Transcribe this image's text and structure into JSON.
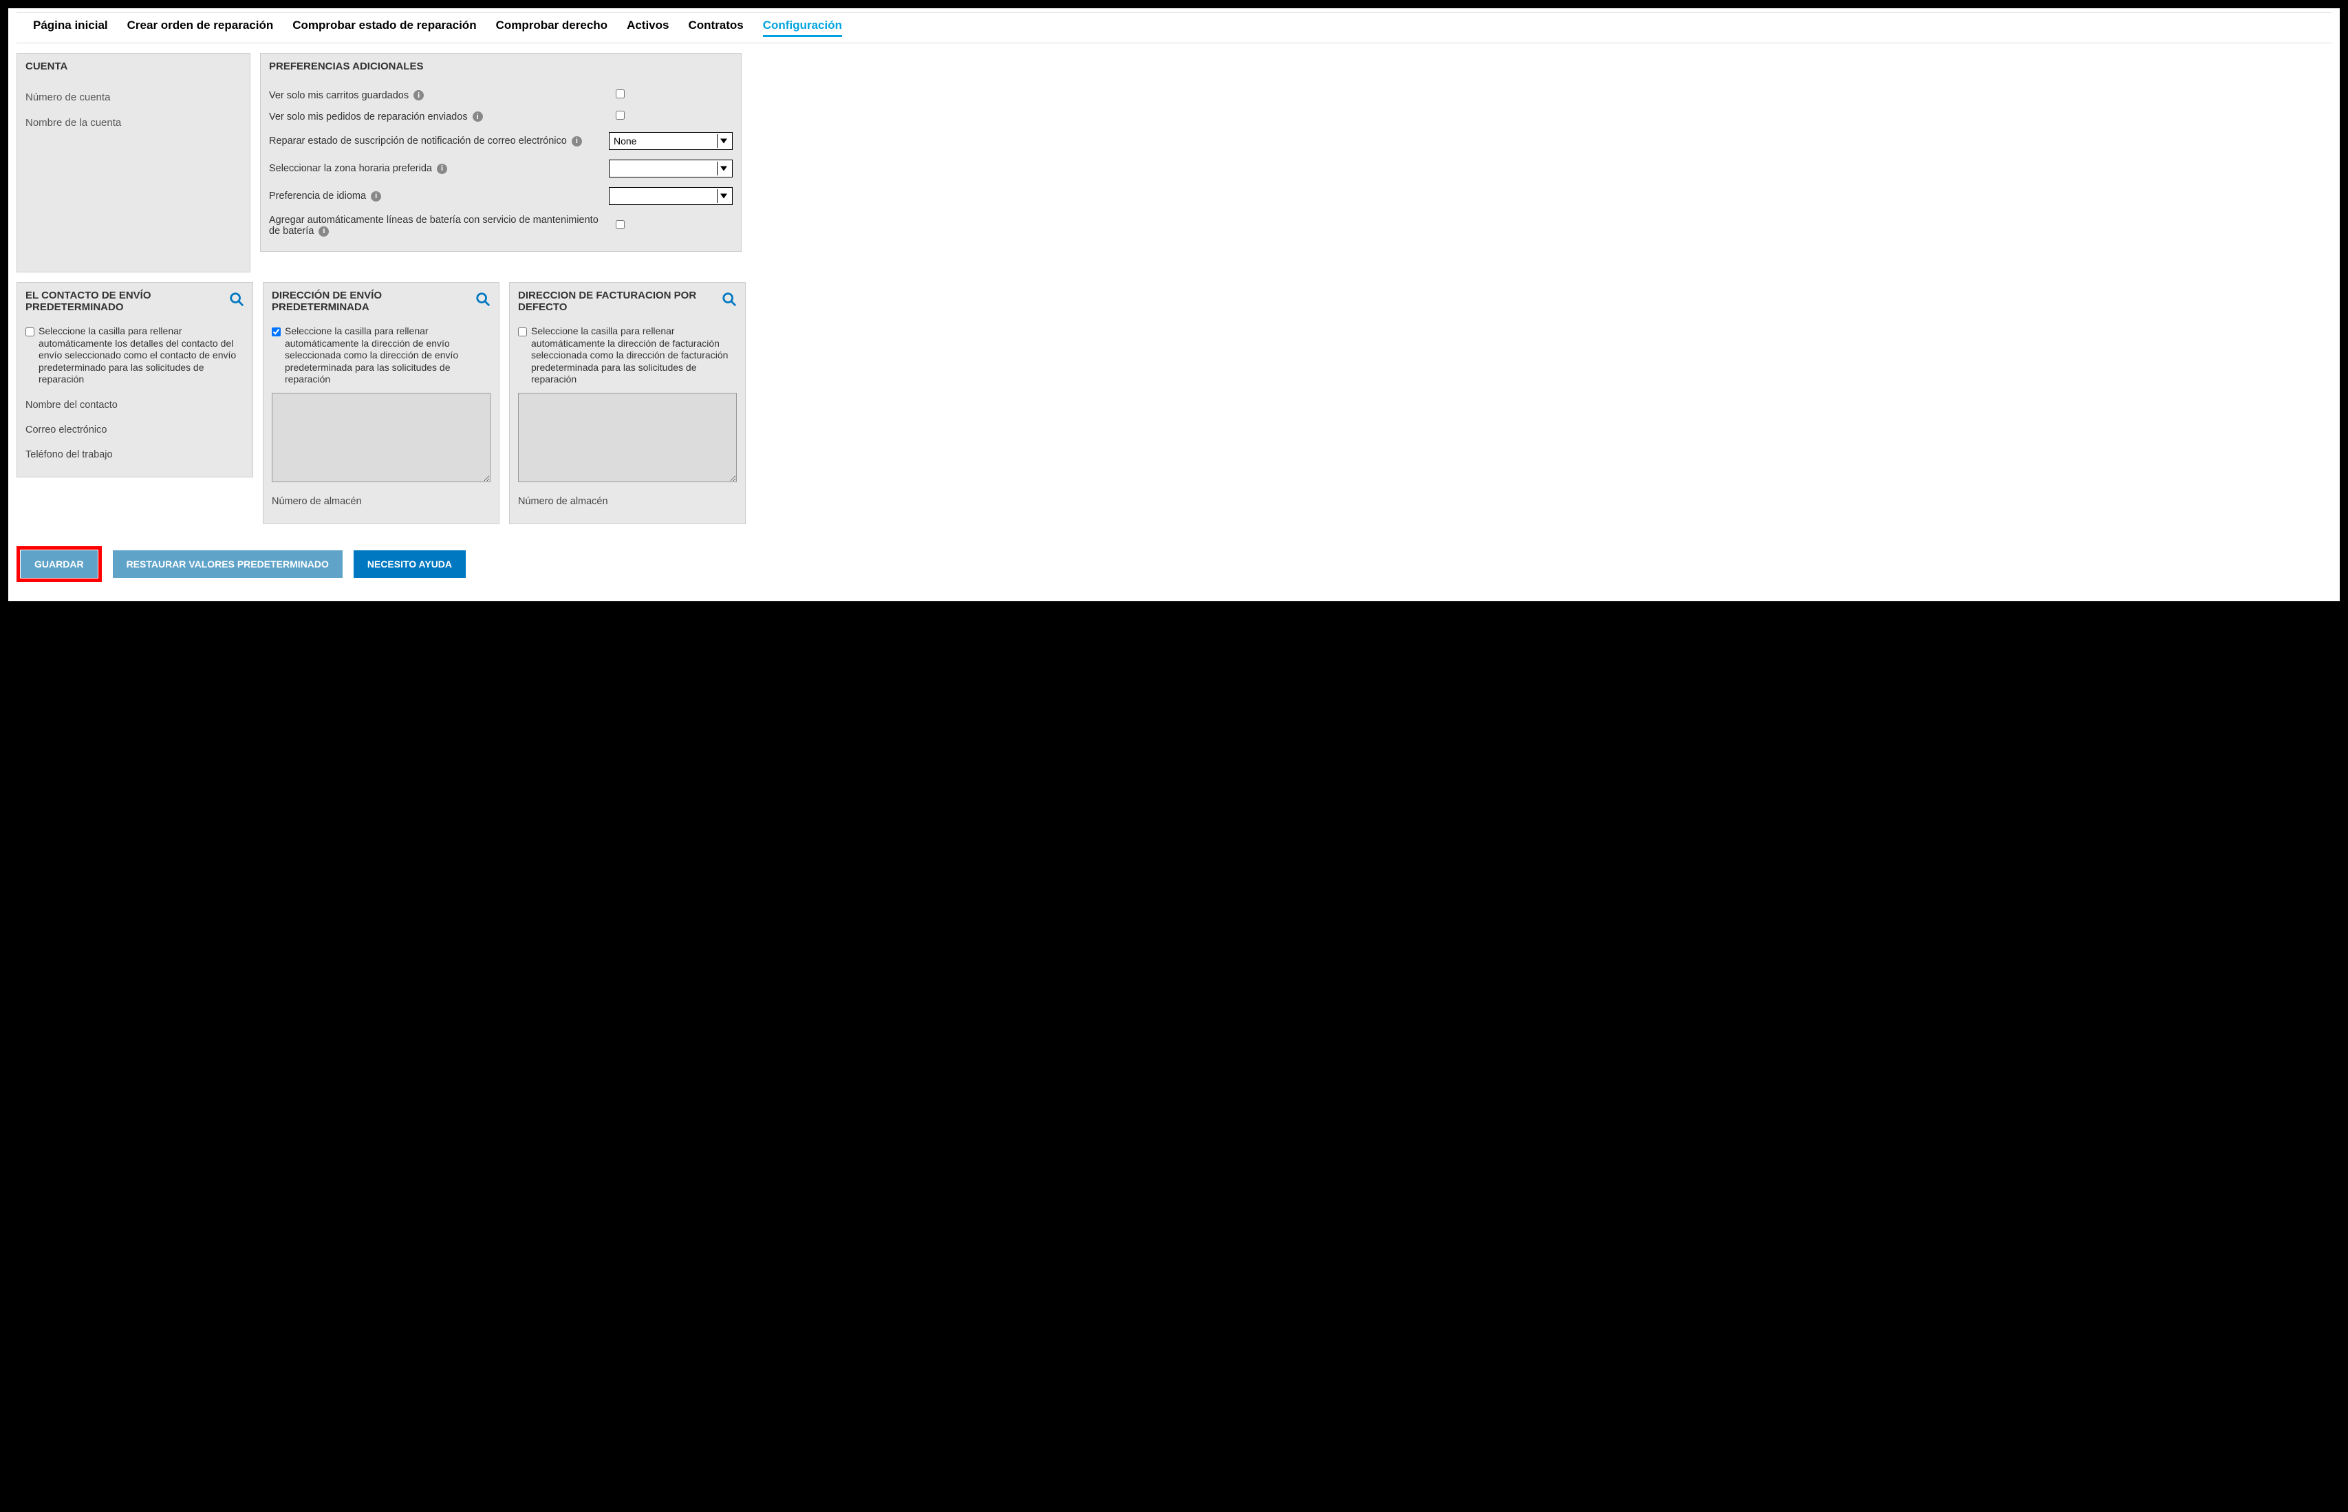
{
  "tabs": {
    "home": "Página inicial",
    "create": "Crear orden de reparación",
    "check_status": "Comprobar estado de reparación",
    "check_right": "Comprobar derecho",
    "assets": "Activos",
    "contracts": "Contratos",
    "config": "Configuración"
  },
  "account": {
    "header": "CUENTA",
    "number_label": "Número de cuenta",
    "name_label": "Nombre de la cuenta"
  },
  "prefs": {
    "header": "PREFERENCIAS ADICIONALES",
    "only_my_carts": "Ver solo mis carritos guardados",
    "only_my_orders": "Ver solo mis pedidos de reparación enviados",
    "email_sub": "Reparar estado de suscripción de notificación de correo electrónico",
    "email_sub_value": "None",
    "timezone": "Seleccionar la zona horaria preferida",
    "timezone_value": "",
    "language": "Preferencia de idioma",
    "language_value": "",
    "auto_battery": "Agregar automáticamente líneas de batería con servicio de mantenimiento de batería"
  },
  "contact": {
    "header": "EL CONTACTO DE ENVÍO PREDETERMINADO",
    "check_text": "Seleccione la casilla para rellenar automáticamente los detalles del contacto del envío seleccionado como el contacto de envío predeterminado para las solicitudes de reparación",
    "name_label": "Nombre del contacto",
    "email_label": "Correo electrónico",
    "phone_label": "Teléfono del trabajo"
  },
  "ship_addr": {
    "header": "DIRECCIÓN DE ENVÍO PREDETERMINADA",
    "check_text": "Seleccione la casilla para rellenar automáticamente la dirección de envío seleccionada como la dirección de envío predeterminada para las solicitudes de reparación",
    "warehouse_label": "Número de almacén"
  },
  "bill_addr": {
    "header": "DIRECCION DE FACTURACION POR DEFECTO",
    "check_text": "Seleccione la casilla para rellenar automáticamente la dirección de facturación seleccionada como la dirección de facturación predeterminada para las solicitudes de reparación",
    "warehouse_label": "Número de almacén"
  },
  "buttons": {
    "save": "GUARDAR",
    "restore": "RESTAURAR VALORES PREDETERMINADO",
    "help": "NECESITO AYUDA"
  },
  "icons": {
    "info_glyph": "i"
  }
}
